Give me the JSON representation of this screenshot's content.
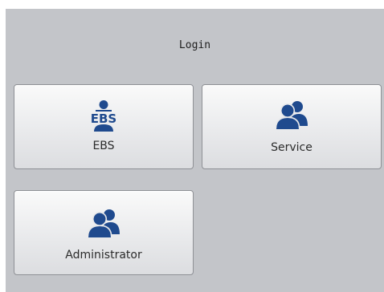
{
  "login": {
    "title": "Login"
  },
  "tiles": [
    {
      "label": "EBS",
      "icon": "ebs-user-icon"
    },
    {
      "label": "Service",
      "icon": "users-icon"
    },
    {
      "label": "Administrator",
      "icon": "users-icon"
    }
  ],
  "colors": {
    "background": "#c3c5c9",
    "icon": "#1f4a8e",
    "tile_border": "#8e9095"
  }
}
